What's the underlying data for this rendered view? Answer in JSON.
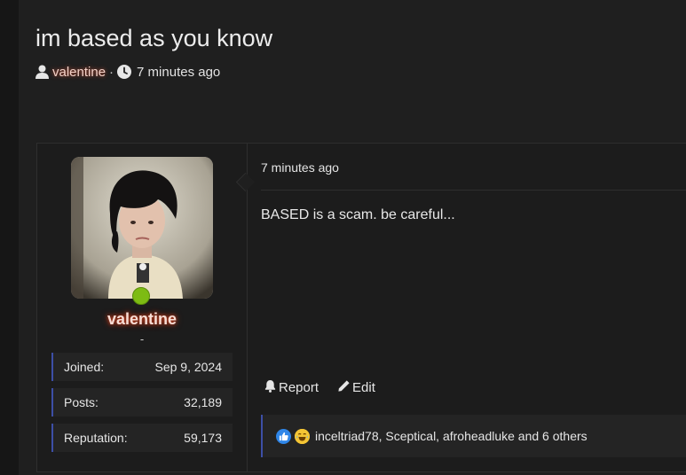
{
  "thread": {
    "title": "im based as you know",
    "author": "valentine",
    "separator": "·",
    "time": "7 minutes ago"
  },
  "post": {
    "user": {
      "name": "valentine",
      "title": "-",
      "stats": [
        {
          "label": "Joined:",
          "value": "Sep 9, 2024"
        },
        {
          "label": "Posts:",
          "value": "32,189"
        },
        {
          "label": "Reputation:",
          "value": "59,173"
        }
      ],
      "online": true
    },
    "time": "7 minutes ago",
    "body": "BASED is a scam. be careful...",
    "actions": {
      "report": "Report",
      "edit": "Edit"
    },
    "reactions": {
      "icons": [
        "like-icon",
        "laugh-icon"
      ],
      "users_text": "inceltriad78, Sceptical, afroheadluke and 6 others"
    }
  },
  "colors": {
    "online": "#7dbb13",
    "accent_border": "#3d4fa6",
    "username_glow": "#d0411f"
  }
}
